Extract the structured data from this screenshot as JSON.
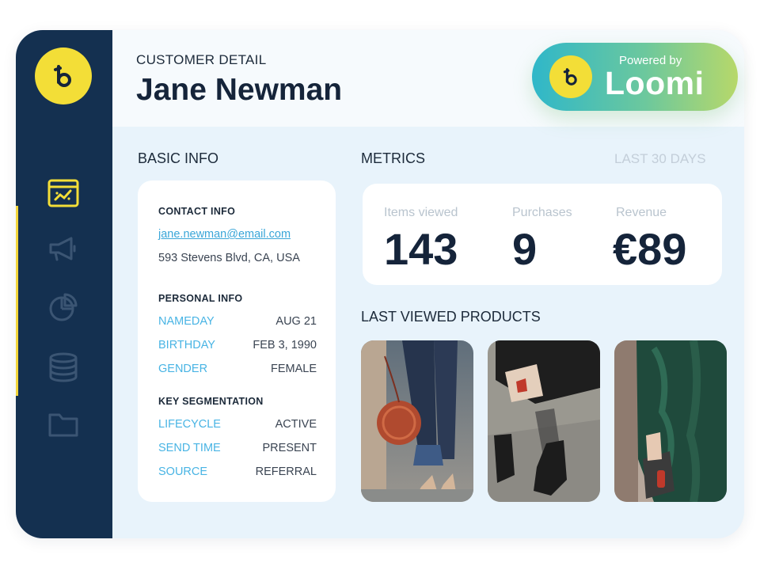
{
  "sidebar": {
    "logo_icon": "bloomreach-logo",
    "items": [
      {
        "icon": "dashboard-icon",
        "active": true
      },
      {
        "icon": "megaphone-icon",
        "active": false
      },
      {
        "icon": "pie-chart-icon",
        "active": false
      },
      {
        "icon": "database-icon",
        "active": false
      },
      {
        "icon": "folder-icon",
        "active": false
      }
    ]
  },
  "header": {
    "eyebrow": "CUSTOMER DETAIL",
    "title": "Jane Newman"
  },
  "badge": {
    "powered_by": "Powered by",
    "brand": "Loomi"
  },
  "basic_info": {
    "heading": "BASIC INFO",
    "contact": {
      "heading": "CONTACT INFO",
      "email": "jane.newman@email.com",
      "address": "593 Stevens Blvd, CA, USA"
    },
    "personal": {
      "heading": "PERSONAL INFO",
      "rows": [
        {
          "key": "NAMEDAY",
          "value": "AUG 21"
        },
        {
          "key": "BIRTHDAY",
          "value": "FEB 3, 1990"
        },
        {
          "key": "GENDER",
          "value": "FEMALE"
        }
      ]
    },
    "segmentation": {
      "heading": "KEY SEGMENTATION",
      "rows": [
        {
          "key": "LIFECYCLE",
          "value": "ACTIVE"
        },
        {
          "key": "SEND TIME",
          "value": "PRESENT"
        },
        {
          "key": "SOURCE",
          "value": "REFERRAL"
        }
      ]
    }
  },
  "metrics": {
    "heading": "METRICS",
    "range": "LAST 30 DAYS",
    "items": [
      {
        "label": "Items viewed",
        "value": "143"
      },
      {
        "label": "Purchases",
        "value": "9"
      },
      {
        "label": "Revenue",
        "value": "€89"
      }
    ]
  },
  "products": {
    "heading": "LAST VIEWED PRODUCTS",
    "items": [
      {
        "image": "red-round-handbag-photo"
      },
      {
        "image": "black-ankle-boots-photo"
      },
      {
        "image": "green-faux-fur-coat-photo"
      }
    ]
  },
  "colors": {
    "sidebar": "#143050",
    "accent_yellow": "#f3de37",
    "link_blue": "#48b4e4",
    "text_dark": "#15243a"
  }
}
